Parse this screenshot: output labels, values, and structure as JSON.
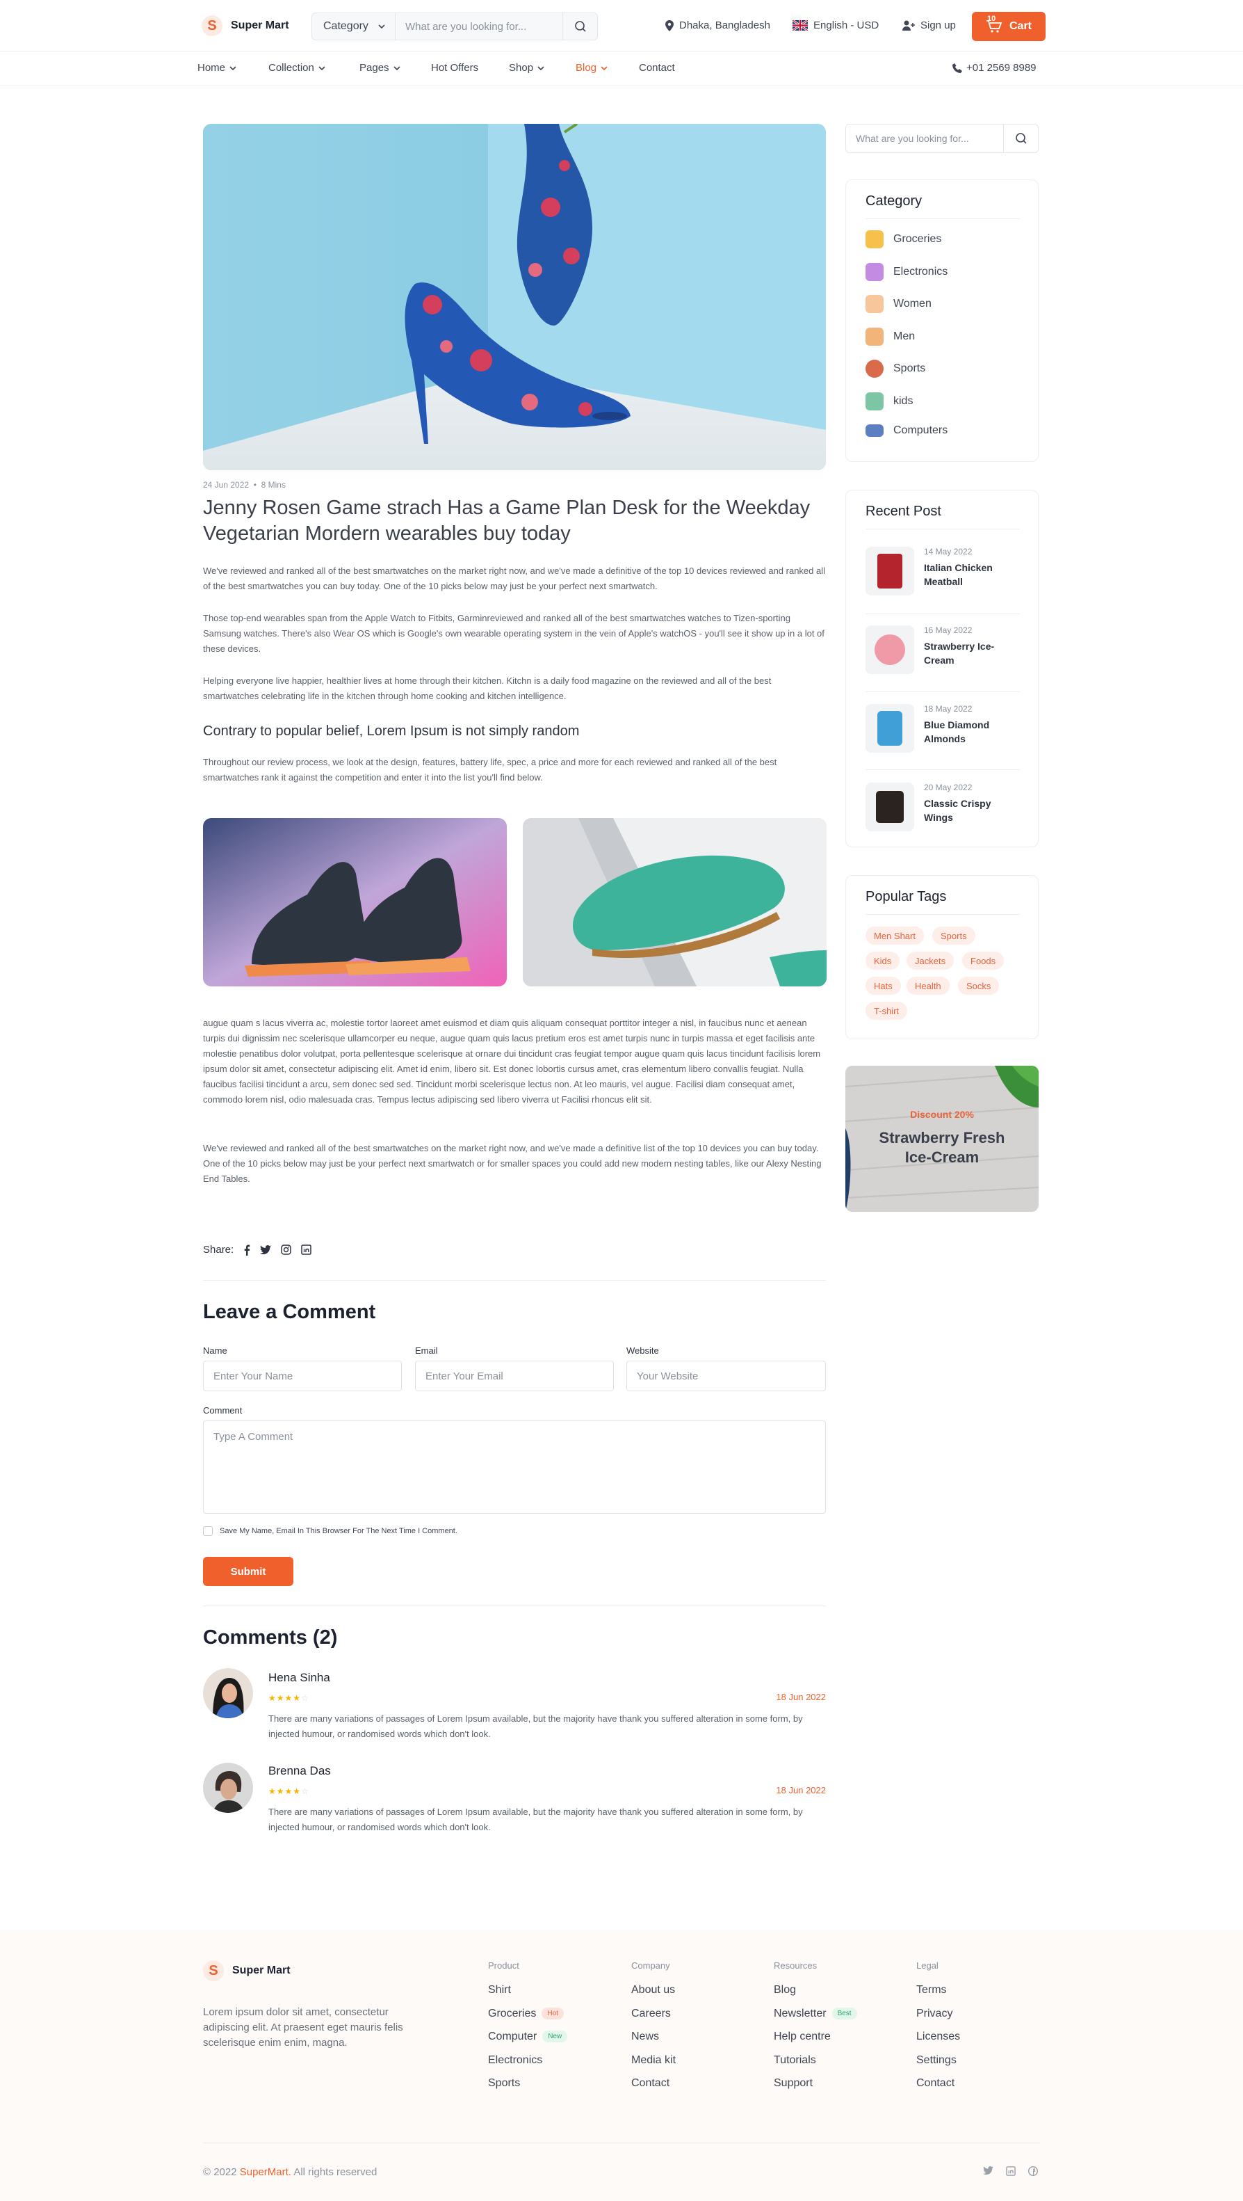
{
  "header": {
    "brand": "Super Mart",
    "logo_letter": "S",
    "search": {
      "category": "Category",
      "placeholder": "What are you looking for..."
    },
    "location": "Dhaka, Bangladesh",
    "language": "English - USD",
    "signup": "Sign up",
    "cart_label": "Cart",
    "cart_count": "10"
  },
  "nav": {
    "items": [
      "Home",
      "Collection",
      "Pages",
      "Hot Offers",
      "Shop",
      "Blog",
      "Contact"
    ],
    "active": "Blog",
    "phone": "+01 2569 8989"
  },
  "article": {
    "date": "24 Jun 2022",
    "read_time": "8 Mins",
    "title": "Jenny Rosen Game strach Has a Game Plan Desk for the Weekday Vegetarian Mordern wearables buy today",
    "p1": "We've reviewed and ranked all of the best smartwatches on the market right now, and we've made a definitive of the top 10 devices reviewed and ranked all of the best smartwatches you can buy today. One of the 10 picks below may just be your perfect next smartwatch.",
    "p2": "Those top-end wearables span from the Apple Watch to Fitbits, Garminreviewed and ranked all of the best smartwatches watches to Tizen-sporting Samsung watches. There's also Wear OS which is Google's own wearable operating system in the vein of Apple's watchOS - you'll see it show up in a lot of these devices.",
    "p3": "Helping everyone live happier, healthier lives at home through their kitchen. Kitchn is a daily food magazine on the reviewed and all of the best smartwatches celebrating life in the kitchen through home cooking and kitchen intelligence.",
    "subheading": "Contrary to popular belief, Lorem Ipsum is not simply random",
    "p4": "Throughout our review process, we look at the design, features, battery life, spec, a price and more for each reviewed and ranked all of the best smartwatches rank it against the competition and enter it into the list you'll find below.",
    "p5": "augue quam s lacus viverra ac, molestie tortor laoreet amet euismod et diam quis aliquam consequat porttitor integer a nisl, in faucibus nunc et aenean turpis dui dignissim nec scelerisque ullamcorper eu neque, augue quam quis lacus pretium eros est amet turpis nunc in turpis massa et eget facilisis ante molestie penatibus dolor volutpat, porta pellentesque scelerisque at ornare dui tincidunt cras feugiat tempor augue quam quis lacus tincidunt facilisis lorem ipsum dolor sit amet, consectetur adipiscing elit. Amet id enim, libero sit. Est donec lobortis cursus amet, cras elementum libero convallis feugiat. Nulla faucibus facilisi tincidunt a arcu, sem donec sed sed. Tincidunt morbi scelerisque lectus non. At leo mauris, vel augue. Facilisi diam consequat amet, commodo lorem nisl, odio malesuada cras. Tempus lectus adipiscing sed libero viverra ut Facilisi rhoncus elit sit.",
    "p6": "We've reviewed and ranked all of the best smartwatches on the market right now, and we've made a definitive list of the top 10 devices you can buy today. One of the 10 picks below may just be your perfect next smartwatch or for smaller spaces you could add new modern nesting tables, like our Alexy Nesting End Tables.",
    "share_label": "Share:"
  },
  "comment_form": {
    "heading": "Leave a Comment",
    "name_label": "Name",
    "name_placeholder": "Enter Your Name",
    "email_label": "Email",
    "email_placeholder": "Enter Your Email",
    "website_label": "Website",
    "website_placeholder": "Your Website",
    "comment_label": "Comment",
    "comment_placeholder": "Type A Comment",
    "save_text": "Save My Name, Email In This Browser For The Next Time I Comment.",
    "submit": "Submit"
  },
  "comments": {
    "heading": "Comments (2)",
    "items": [
      {
        "name": "Hena Sinha",
        "date": "18 Jun 2022",
        "rating": 4,
        "text": "There are many variations of passages of Lorem Ipsum available, but the majority have thank you suffered alteration in some form, by injected humour, or randomised words which don't look."
      },
      {
        "name": "Brenna Das",
        "date": "18 Jun 2022",
        "rating": 4,
        "text": "There are many variations of passages of Lorem Ipsum available, but the majority have thank you suffered alteration in some form, by injected humour, or randomised words which don't look."
      }
    ]
  },
  "sidebar": {
    "search_placeholder": "What are you looking for...",
    "category_title": "Category",
    "categories": [
      "Groceries",
      "Electronics",
      "Women",
      "Men",
      "Sports",
      "kids",
      "Computers"
    ],
    "recent_title": "Recent Post",
    "recent": [
      {
        "date": "14 May 2022",
        "title": "Italian Chicken Meatball"
      },
      {
        "date": "16 May 2022",
        "title": "Strawberry Ice-Cream"
      },
      {
        "date": "18 May 2022",
        "title": "Blue Diamond Almonds"
      },
      {
        "date": "20 May 2022",
        "title": "Classic Crispy Wings"
      }
    ],
    "tags_title": "Popular Tags",
    "tags": [
      "Men Shart",
      "Sports",
      "Kids",
      "Jackets",
      "Foods",
      "Hats",
      "Health",
      "Socks",
      "T-shirt"
    ],
    "banner": {
      "discount": "Discount 20%",
      "title": "Strawberry Fresh Ice-Cream"
    }
  },
  "footer": {
    "brand": "Super Mart",
    "about": "Lorem ipsum dolor sit amet, consectetur adipiscing elit. At praesent eget mauris felis scelerisque enim enim, magna.",
    "columns": [
      {
        "title": "Product",
        "links": [
          "Shirt",
          "Groceries",
          "Computer",
          "Electronics",
          "Sports"
        ]
      },
      {
        "title": "Company",
        "links": [
          "About us",
          "Careers",
          "News",
          "Media kit",
          "Contact"
        ]
      },
      {
        "title": "Resources",
        "links": [
          "Blog",
          "Newsletter",
          "Help centre",
          "Tutorials",
          "Support"
        ]
      },
      {
        "title": "Legal",
        "links": [
          "Terms",
          "Privacy",
          "Licenses",
          "Settings",
          "Contact"
        ]
      }
    ],
    "badges": {
      "hot": "Hot",
      "new": "New",
      "best": "Best"
    },
    "copyright_prefix": "© 2022",
    "copyright_brand": "SuperMart.",
    "copyright_suffix": "All rights reserved"
  },
  "colors": {
    "accent": "#f0602d",
    "star": "#f4b400",
    "tag_bg": "#fdeee9"
  }
}
